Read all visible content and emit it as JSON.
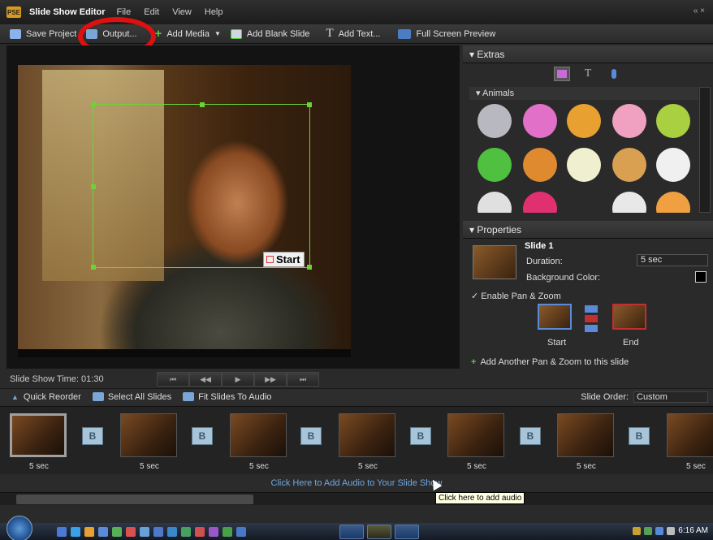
{
  "window": {
    "title": "Slide Show Editor",
    "menu": [
      "File",
      "Edit",
      "View",
      "Help"
    ],
    "controls": "« ×"
  },
  "toolbar": {
    "save": "Save Project",
    "output": "Output...",
    "add_media": "Add Media",
    "add_blank": "Add Blank Slide",
    "add_text": "Add Text...",
    "full_screen": "Full Screen Preview"
  },
  "preview": {
    "start_label": "Start",
    "time_label": "Slide Show Time: 01:30"
  },
  "transport": [
    "⏮",
    "◀◀",
    "▶",
    "▶▶",
    "⏭"
  ],
  "reorder_bar": {
    "quick_reorder": "Quick Reorder",
    "select_all": "Select All Slides",
    "fit_audio": "Fit Slides To Audio",
    "slide_order_label": "Slide Order:",
    "slide_order_value": "Custom"
  },
  "filmstrip": {
    "slides": [
      {
        "duration": "5 sec",
        "selected": true
      },
      {
        "duration": "5 sec"
      },
      {
        "duration": "5 sec"
      },
      {
        "duration": "5 sec"
      },
      {
        "duration": "5 sec"
      },
      {
        "duration": "5 sec"
      },
      {
        "duration": "5 sec"
      }
    ],
    "transition_glyph": "B"
  },
  "audio": {
    "add_link": "Click Here to Add Audio to Your Slide Show",
    "tooltip": "Click here to add audio"
  },
  "extras": {
    "title": "Extras",
    "category": "Animals",
    "text_tab": "T"
  },
  "properties": {
    "title": "Properties",
    "slide_name": "Slide 1",
    "duration_label": "Duration:",
    "duration_value": "5 sec",
    "bg_color_label": "Background Color:",
    "enable_pz": "Enable Pan & Zoom",
    "start_label": "Start",
    "end_label": "End",
    "add_pz": "Add Another Pan & Zoom to this slide"
  },
  "taskbar": {
    "clock": "6:16 AM"
  },
  "colors": {
    "accent_green": "#6cd23a",
    "link_blue": "#6fa8e0",
    "highlight_red": "#e01010",
    "background": "#2a2a2a"
  }
}
